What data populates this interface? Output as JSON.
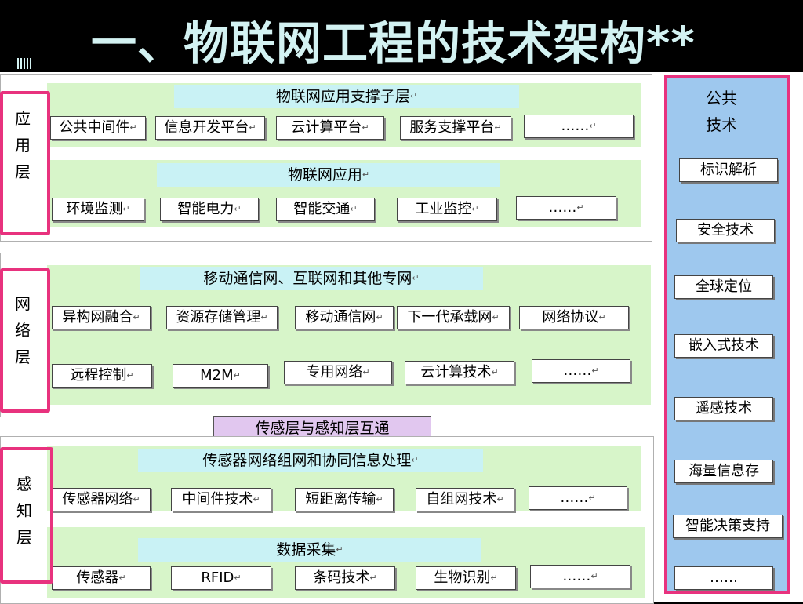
{
  "title": "一、物联网工程的技术架构**",
  "application_layer": {
    "label": [
      "应",
      "用",
      "层"
    ],
    "support": {
      "heading": "物联网应用支撑子层",
      "items": [
        "公共中间件",
        "信息开发平台",
        "云计算平台",
        "服务支撑平台",
        "……"
      ]
    },
    "apps": {
      "heading": "物联网应用",
      "items": [
        "环境监测",
        "智能电力",
        "智能交通",
        "工业监控",
        "……"
      ]
    }
  },
  "network_layer": {
    "label": [
      "网",
      "络",
      "层"
    ],
    "heading": "移动通信网、互联网和其他专网",
    "row1": [
      "异构网融合",
      "资源存储管理",
      "移动通信网",
      "下一代承载网",
      "网络协议"
    ],
    "row2": [
      "远程控制",
      "M2M",
      "专用网络",
      "云计算技术",
      "……"
    ]
  },
  "interconnect_label": "传感层与感知层互通",
  "perception_layer": {
    "label": [
      "感",
      "知",
      "层"
    ],
    "sensor_net": {
      "heading": "传感器网络组网和协同信息处理",
      "items": [
        "传感器网络",
        "中间件技术",
        "短距离传输",
        "自组网技术",
        "……"
      ]
    },
    "collection": {
      "heading": "数据采集",
      "items": [
        "传感器",
        "RFID",
        "条码技术",
        "生物识别",
        "……"
      ]
    }
  },
  "common_tech": {
    "heading": [
      "公共",
      "技术"
    ],
    "items": [
      "标识解析",
      "安全技术",
      "全球定位",
      "嵌入式技术",
      "遥感技术",
      "海量信息存",
      "智能决策支持",
      "……"
    ]
  },
  "colors": {
    "title_text": "#d3f2f2",
    "band": "#d7f5c9",
    "subhead": "#c9f2f5",
    "frame": "#e8327e",
    "right_panel": "#9ec8ee",
    "interconnect": "#e1c7ef"
  }
}
